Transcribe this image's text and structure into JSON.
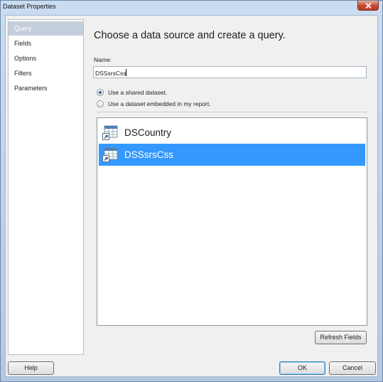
{
  "window": {
    "title": "Dataset Properties"
  },
  "nav": {
    "items": [
      {
        "label": "Query",
        "selected": true
      },
      {
        "label": "Fields",
        "selected": false
      },
      {
        "label": "Options",
        "selected": false
      },
      {
        "label": "Filters",
        "selected": false
      },
      {
        "label": "Parameters",
        "selected": false
      }
    ]
  },
  "main": {
    "heading": "Choose a data source and create a query.",
    "name_label": "Name:",
    "name_value": "DSSsrsCss",
    "radios": [
      {
        "label": "Use a shared dataset.",
        "checked": true
      },
      {
        "label": "Use a dataset embedded in my report.",
        "checked": false
      }
    ],
    "datasets": [
      {
        "label": "DSCountry",
        "icon": "shared-dataset-icon",
        "selected": false
      },
      {
        "label": "DSSsrsCss",
        "icon": "shared-dataset-icon",
        "selected": true
      }
    ],
    "refresh_label": "Refresh Fields"
  },
  "footer": {
    "help_label": "Help",
    "ok_label": "OK",
    "cancel_label": "Cancel"
  },
  "colors": {
    "selection": "#3399ff",
    "nav_selected": "#c4cfdc",
    "close": "#c9472f"
  }
}
